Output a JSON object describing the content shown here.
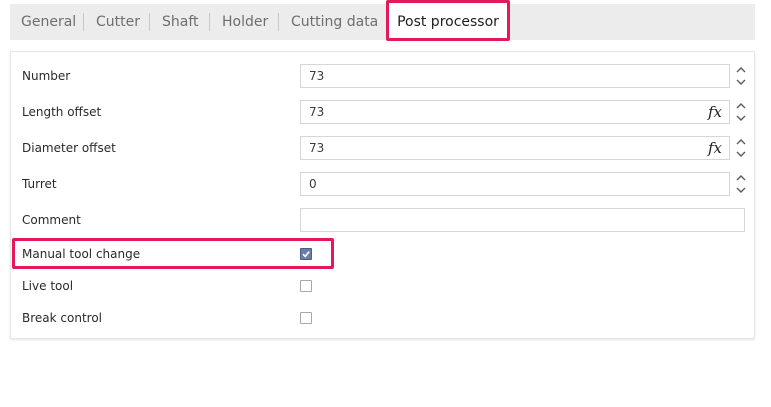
{
  "tabs": [
    {
      "label": "General",
      "active": false
    },
    {
      "label": "Cutter",
      "active": false
    },
    {
      "label": "Shaft",
      "active": false
    },
    {
      "label": "Holder",
      "active": false
    },
    {
      "label": "Cutting data",
      "active": false
    },
    {
      "label": "Post processor",
      "active": true
    }
  ],
  "fields": {
    "number": {
      "label": "Number",
      "value": "73"
    },
    "length_offset": {
      "label": "Length offset",
      "value": "73",
      "fx": "fx"
    },
    "diameter_offset": {
      "label": "Diameter offset",
      "value": "73",
      "fx": "fx"
    },
    "turret": {
      "label": "Turret",
      "value": "0"
    },
    "comment": {
      "label": "Comment",
      "value": ""
    }
  },
  "checkboxes": {
    "manual_tool_change": {
      "label": "Manual tool change",
      "checked": true
    },
    "live_tool": {
      "label": "Live tool",
      "checked": false
    },
    "break_control": {
      "label": "Break control",
      "checked": false
    }
  },
  "colors": {
    "highlight": "#e4185a",
    "checkbox_checked": "#6a7fa8",
    "tabbar_bg": "#ececec"
  }
}
